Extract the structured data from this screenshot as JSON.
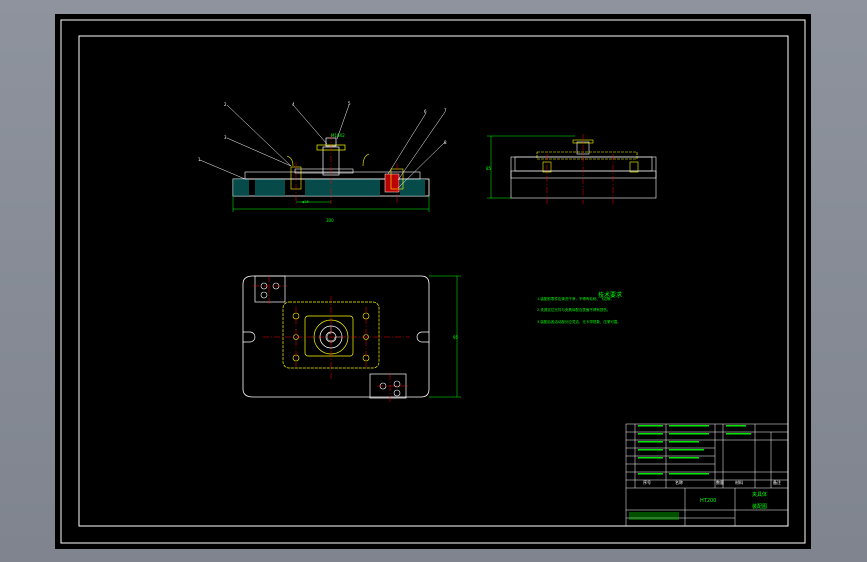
{
  "drawing": {
    "tech_notes": {
      "title": "技术要求",
      "lines": [
        "1.装配前零件应清洗干净，不得有毛刺、飞边等。",
        "2.夹具定位元件与夹具体配合表面不得有损伤。",
        "3.装配后各活动部分应灵活，无卡滞现象，压紧可靠。"
      ]
    },
    "balloons": [
      "1",
      "2",
      "3",
      "4",
      "5",
      "6",
      "7",
      "8"
    ],
    "title_block": {
      "designation": "夹具体",
      "part_name": "装配图",
      "code": "HT200",
      "labels": [
        "序号",
        "名称",
        "数量",
        "材料",
        "备注"
      ]
    },
    "colors": {
      "background": "#000000",
      "outline": "#ffffff",
      "hidden": "#ffff00",
      "center": "#ff0000",
      "dimension": "#00ff00",
      "section": "#00a0a0"
    }
  }
}
